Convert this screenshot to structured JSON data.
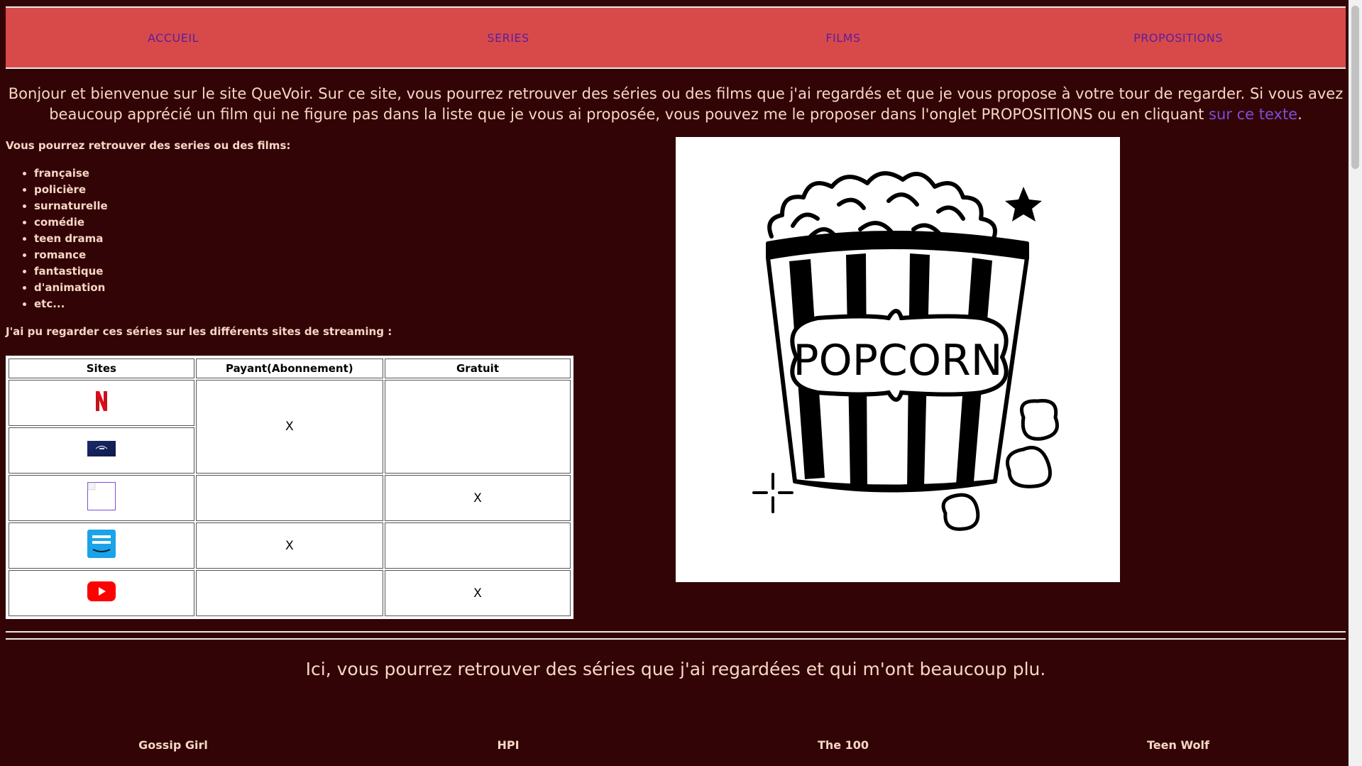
{
  "nav": {
    "items": [
      {
        "label": "ACCUEIL"
      },
      {
        "label": "SERIES"
      },
      {
        "label": "FILMS"
      },
      {
        "label": "PROPOSITIONS"
      }
    ]
  },
  "intro": {
    "text_before_link": "Bonjour et bienvenue sur le site QueVoir. Sur ce site, vous pourrez retrouver des séries ou des films que j'ai regardés et que je vous propose à votre tour de regarder. Si vous avez beaucoup apprécié un film qui ne figure pas dans la liste que je vous ai proposée, vous pouvez me le proposer dans l'onglet PROPOSITIONS ou en cliquant ",
    "link_text": "sur ce texte",
    "text_after_link": "."
  },
  "genres": {
    "heading": "Vous pourrez retrouver des series ou des films:",
    "items": [
      "française",
      "policière",
      "surnaturelle",
      "comédie",
      "teen drama",
      "romance",
      "fantastique",
      "d'animation",
      "etc..."
    ]
  },
  "streaming": {
    "heading": "J'ai pu regarder ces séries sur les différents sites de streaming :",
    "headers": [
      "Sites",
      "Payant(Abonnement)",
      "Gratuit"
    ],
    "mark": "X"
  },
  "hero": {
    "label": "POPCORN"
  },
  "series_section": {
    "intro": "Ici, vous pourrez retrouver des séries que j'ai regardées et qui m'ont beaucoup plu.",
    "titles": [
      "Gossip Girl",
      "HPI",
      "The 100",
      "Teen Wolf"
    ]
  },
  "colors": {
    "background": "#330406",
    "nav_background": "#d84a4a",
    "nav_text": "#5b1e9e",
    "body_text": "#f6d7c4",
    "link": "#7a4fd8"
  }
}
